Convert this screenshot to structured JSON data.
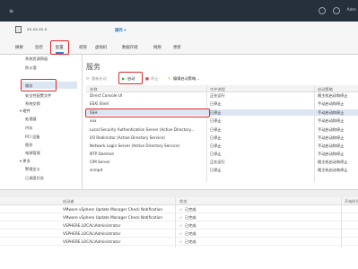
{
  "topbar": {
    "user": "Adm"
  },
  "header": {
    "host": "xx.xx.xx.x",
    "actions_label": "操作 ▾"
  },
  "tabs": [
    "摘要",
    "监控",
    "配置",
    "权限",
    "虚拟机",
    "数据存储",
    "网络",
    "更新"
  ],
  "left_nav": [
    {
      "label": "系统资源预留",
      "indent": 1
    },
    {
      "label": "防火墙",
      "indent": 1
    },
    {
      "label": "服务",
      "indent": 1,
      "selected": true
    },
    {
      "label": "安全性配置文件",
      "indent": 1
    },
    {
      "label": "系统交换",
      "indent": 1
    },
    {
      "label": "▾ 硬件",
      "indent": 0
    },
    {
      "label": "处理器",
      "indent": 1
    },
    {
      "label": "内存",
      "indent": 1
    },
    {
      "label": "PCI 设备",
      "indent": 1
    },
    {
      "label": "图形",
      "indent": 1
    },
    {
      "label": "电源管理",
      "indent": 1
    },
    {
      "label": "▾ 更多",
      "indent": 0
    },
    {
      "label": "警报定义",
      "indent": 1
    },
    {
      "label": "已调度任务",
      "indent": 1
    }
  ],
  "main": {
    "title": "服务",
    "toolbar": {
      "restart": "重新启动",
      "start": "启动",
      "stop": "停止",
      "edit_policy": "编辑启动策略..."
    },
    "columns": [
      "名称",
      "守护进程",
      "启动策略"
    ],
    "rows": [
      {
        "name": "Direct Console UI",
        "daemon": "正在运行",
        "policy": "随主机启动和停止"
      },
      {
        "name": "ESXi Shell",
        "daemon": "已停止",
        "policy": "手动启动和停止"
      },
      {
        "name": "SSH",
        "daemon": "已停止",
        "policy": "手动启动和停止",
        "selected": true
      },
      {
        "name": "xxx",
        "daemon": "已停止",
        "policy": "手动启动和停止"
      },
      {
        "name": "Local Security Authentication Server (Active Directory...",
        "daemon": "已停止",
        "policy": "手动启动和停止"
      },
      {
        "name": "I/O Redirector (Active Directory Service)",
        "daemon": "已停止",
        "policy": "手动启动和停止"
      },
      {
        "name": "Network Login Server (Active Directory Service)",
        "daemon": "已停止",
        "policy": "手动启动和停止"
      },
      {
        "name": "NTP Daemon",
        "daemon": "已停止",
        "policy": "手动启动和停止"
      },
      {
        "name": "CIM Server",
        "daemon": "正在运行",
        "policy": "随主机启动和停止"
      },
      {
        "name": "snmpd",
        "daemon": "已停止",
        "policy": "随主机启动和停止"
      }
    ]
  },
  "tasks": {
    "columns": [
      "启动者",
      "状态",
      "开始时间"
    ],
    "rows": [
      {
        "initiator": "VMware vSphere Update Manager Check Notification",
        "status": "已完成"
      },
      {
        "initiator": "VMware vSphere Update Manager Check Notification",
        "status": "已完成"
      },
      {
        "initiator": "VSPHERE.LOCAL\\Administrator",
        "status": "已完成"
      },
      {
        "initiator": "VSPHERE.LOCAL\\Administrator",
        "status": "已完成"
      },
      {
        "initiator": "VSPHERE.LOCAL\\Administrator",
        "status": "已完成"
      }
    ]
  },
  "colors": {
    "accent": "#3a7ed1",
    "highlight_box": "#e02a2a",
    "start_green": "#2a9a3a"
  }
}
